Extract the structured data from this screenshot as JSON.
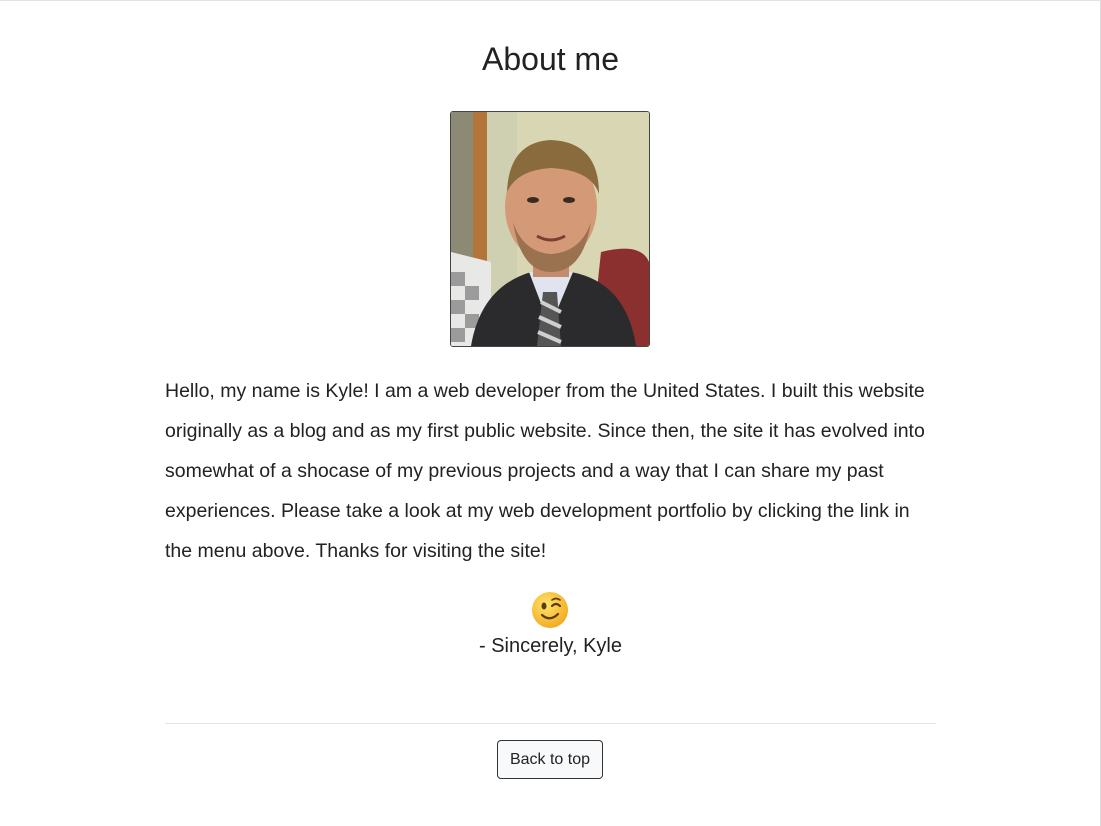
{
  "page": {
    "title": "About me"
  },
  "profile_photo": {
    "description_icon": "portrait-photo"
  },
  "bio": {
    "text": "Hello, my name is Kyle! I am a web developer from the United States. I built this website originally as a blog and as my first public website. Since then, the site it has evolved into somewhat of a shocase of my previous projects and a way that I can share my past experiences. Please take a look at my web development portfolio by clicking the link in the menu above. Thanks for visiting the site!"
  },
  "emoji": {
    "icon": "winking-face-icon"
  },
  "signature": {
    "text": "- Sincerely, Kyle"
  },
  "footer": {
    "back_to_top_label": "Back to top"
  },
  "colors": {
    "text": "#222222",
    "button_background": "#f8f9fb",
    "divider": "#e3e3e3",
    "emoji_face": "#f7b733"
  }
}
